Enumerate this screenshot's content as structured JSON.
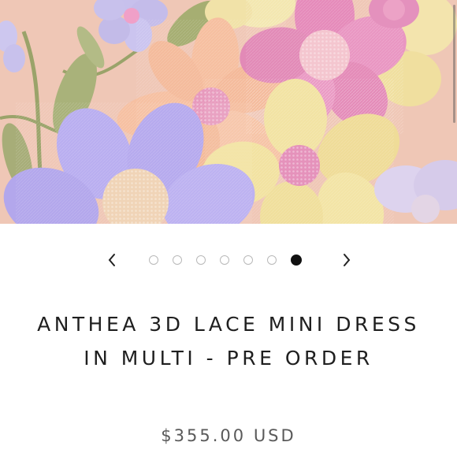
{
  "gallery": {
    "image_description_icon": "floral-lace-photo",
    "prev_icon": "chevron-left-icon",
    "next_icon": "chevron-right-icon",
    "dot_count": 7,
    "active_index": 6
  },
  "product": {
    "title": "ANTHEA 3D LACE MINI DRESS IN MULTI - PRE ORDER",
    "price": "$355.00 USD"
  },
  "colors": {
    "background": "#ffffff",
    "text": "#1f1f1f",
    "price_text": "#5a5a5a",
    "dot_active": "#111111",
    "dot_inactive_border": "#b9b9b9"
  }
}
